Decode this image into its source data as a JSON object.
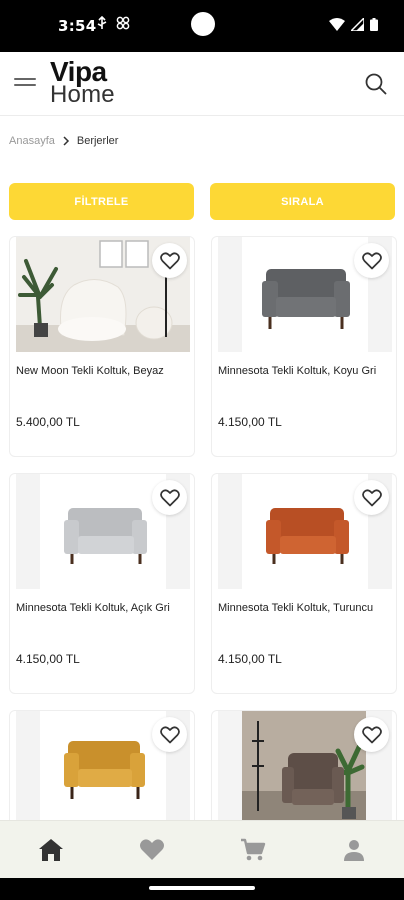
{
  "status_bar": {
    "time": "3:54"
  },
  "header": {
    "logo_top": "Vipa",
    "logo_bottom": "Home"
  },
  "breadcrumb": {
    "home": "Anasayfa",
    "current": "Berjerler"
  },
  "actions": {
    "filter_label": "FİLTRELE",
    "sort_label": "SIRALA"
  },
  "products": [
    {
      "name": "New Moon Tekli Koltuk, Beyaz",
      "price": "5.400,00 TL",
      "color": "#efece8"
    },
    {
      "name": "Minnesota Tekli Koltuk, Koyu Gri",
      "price": "4.150,00 TL",
      "color": "#6b6d70"
    },
    {
      "name": "Minnesota Tekli Koltuk, Açık Gri",
      "price": "4.150,00 TL",
      "color": "#c5c7ca"
    },
    {
      "name": "Minnesota Tekli Koltuk, Turuncu",
      "price": "4.150,00 TL",
      "color": "#c4582a"
    },
    {
      "name": "",
      "price": "",
      "color": "#d9a23a"
    },
    {
      "name": "",
      "price": "",
      "color": "#6a5a52"
    }
  ],
  "bottom_nav": [
    {
      "icon": "home-icon",
      "active": true
    },
    {
      "icon": "heart-icon",
      "active": false
    },
    {
      "icon": "cart-icon",
      "active": false
    },
    {
      "icon": "user-icon",
      "active": false
    }
  ],
  "colors": {
    "accent": "#fdd835",
    "nav_active": "#333333",
    "nav_inactive": "#999999"
  }
}
